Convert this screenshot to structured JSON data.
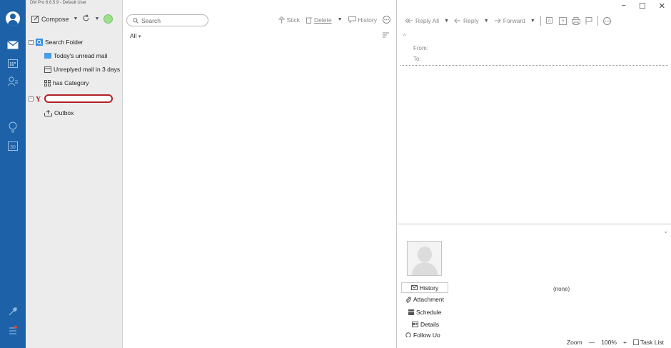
{
  "app": {
    "title": "DM Pro 6.6.5.9 - Default User"
  },
  "folder_toolbar": {
    "compose_label": "Compose"
  },
  "folders": {
    "search_folder": "Search Folder",
    "todays_unread": "Today's unread mail",
    "unreplied": "Unreplyed mail in 3 days",
    "has_category": "has Category",
    "outbox": "Outbox"
  },
  "search": {
    "placeholder": "Search"
  },
  "list_toolbar": {
    "stick": "Stick",
    "delete": "Delete",
    "history": "History"
  },
  "list": {
    "filter": "All"
  },
  "reader_toolbar": {
    "reply_all": "Reply All",
    "reply": "Reply",
    "forward": "Forward"
  },
  "message_header": {
    "from_label": "From:",
    "to_label": "To:"
  },
  "contact": {
    "tabs": [
      "History",
      "Attachment",
      "Schedule",
      "Details",
      "Follow Up"
    ],
    "none_text": "(none)"
  },
  "status_bar": {
    "zoom_label": "Zoom",
    "zoom_value": "100%",
    "task_list": "Task List"
  },
  "colors": {
    "rail": "#1d62a8",
    "folder_bg": "#ececec",
    "status_green": "#9be08a",
    "redaction": "#b01f24"
  }
}
